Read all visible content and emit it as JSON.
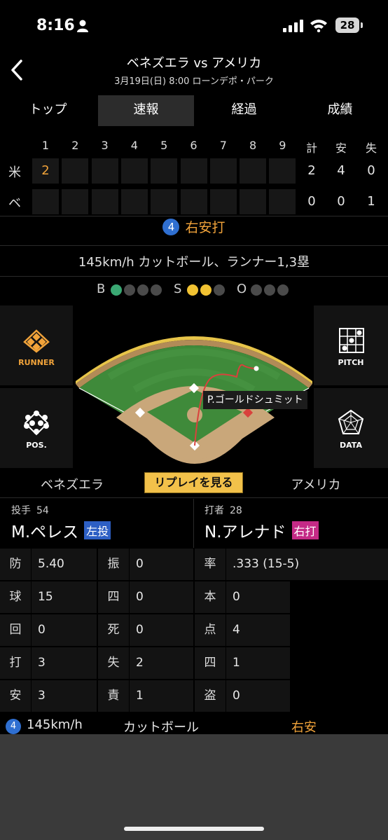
{
  "status_bar": {
    "time": "8:16",
    "battery": "28"
  },
  "header": {
    "title": "ベネズエラ vs アメリカ",
    "subtitle": "3月19日(日) 8:00 ローンデポ・パーク"
  },
  "tabs": [
    "トップ",
    "速報",
    "経過",
    "成績"
  ],
  "active_tab": "速報",
  "scoreboard": {
    "innings": [
      "1",
      "2",
      "3",
      "4",
      "5",
      "6",
      "7",
      "8",
      "9"
    ],
    "totals_headers": [
      "計",
      "安",
      "失"
    ],
    "teams": [
      {
        "abbr": "米",
        "innings": [
          "2",
          "",
          "",
          "",
          "",
          "",
          "",
          "",
          ""
        ],
        "totals": [
          "2",
          "4",
          "0"
        ]
      },
      {
        "abbr": "ベ",
        "innings": [
          "",
          "",
          "",
          "",
          "",
          "",
          "",
          "",
          ""
        ],
        "totals": [
          "0",
          "0",
          "1"
        ]
      }
    ]
  },
  "play": {
    "number": "4",
    "result": "右安打",
    "description": "145km/h カットボール、ランナー1,3塁"
  },
  "count": {
    "balls_label": "B",
    "strikes_label": "S",
    "outs_label": "O",
    "balls": 1,
    "strikes": 2,
    "outs": 0
  },
  "field": {
    "buttons": {
      "runner": "RUNNER",
      "pitch": "PITCH",
      "pos": "POS.",
      "data": "DATA"
    },
    "fielder": "P.ゴールドシュミット",
    "colors": {
      "grass": "#3f8a3a",
      "dirt": "#c9a77a",
      "wall": "#e7c449",
      "ball_path": "#d9413c"
    }
  },
  "replay_row": {
    "team_left": "ベネズエラ",
    "replay_label": "リプレイを見る",
    "team_right": "アメリカ"
  },
  "pitcher": {
    "role": "投手",
    "number": "54",
    "name": "M.ペレス",
    "hand": "左投",
    "hand_color": "#2d5fc4",
    "stats": [
      {
        "k": "防",
        "v": "5.40"
      },
      {
        "k": "振",
        "v": "0"
      },
      {
        "k": "球",
        "v": "15"
      },
      {
        "k": "四",
        "v": "0"
      },
      {
        "k": "回",
        "v": "0"
      },
      {
        "k": "死",
        "v": "0"
      },
      {
        "k": "打",
        "v": "3"
      },
      {
        "k": "失",
        "v": "2"
      },
      {
        "k": "安",
        "v": "3"
      },
      {
        "k": "責",
        "v": "1"
      }
    ]
  },
  "batter": {
    "role": "打者",
    "number": "28",
    "name": "N.アレナド",
    "hand": "右打",
    "hand_color": "#c42a86",
    "stats": [
      {
        "k": "率",
        "v": ".333 (15-5)"
      },
      {
        "k": "本",
        "v": "0"
      },
      {
        "k": "点",
        "v": "4"
      },
      {
        "k": "四",
        "v": "1"
      },
      {
        "k": "盗",
        "v": "0"
      }
    ]
  },
  "pitch_log": {
    "number": "4",
    "speed": "145km/h",
    "type": "カットボール",
    "result": "右安"
  }
}
